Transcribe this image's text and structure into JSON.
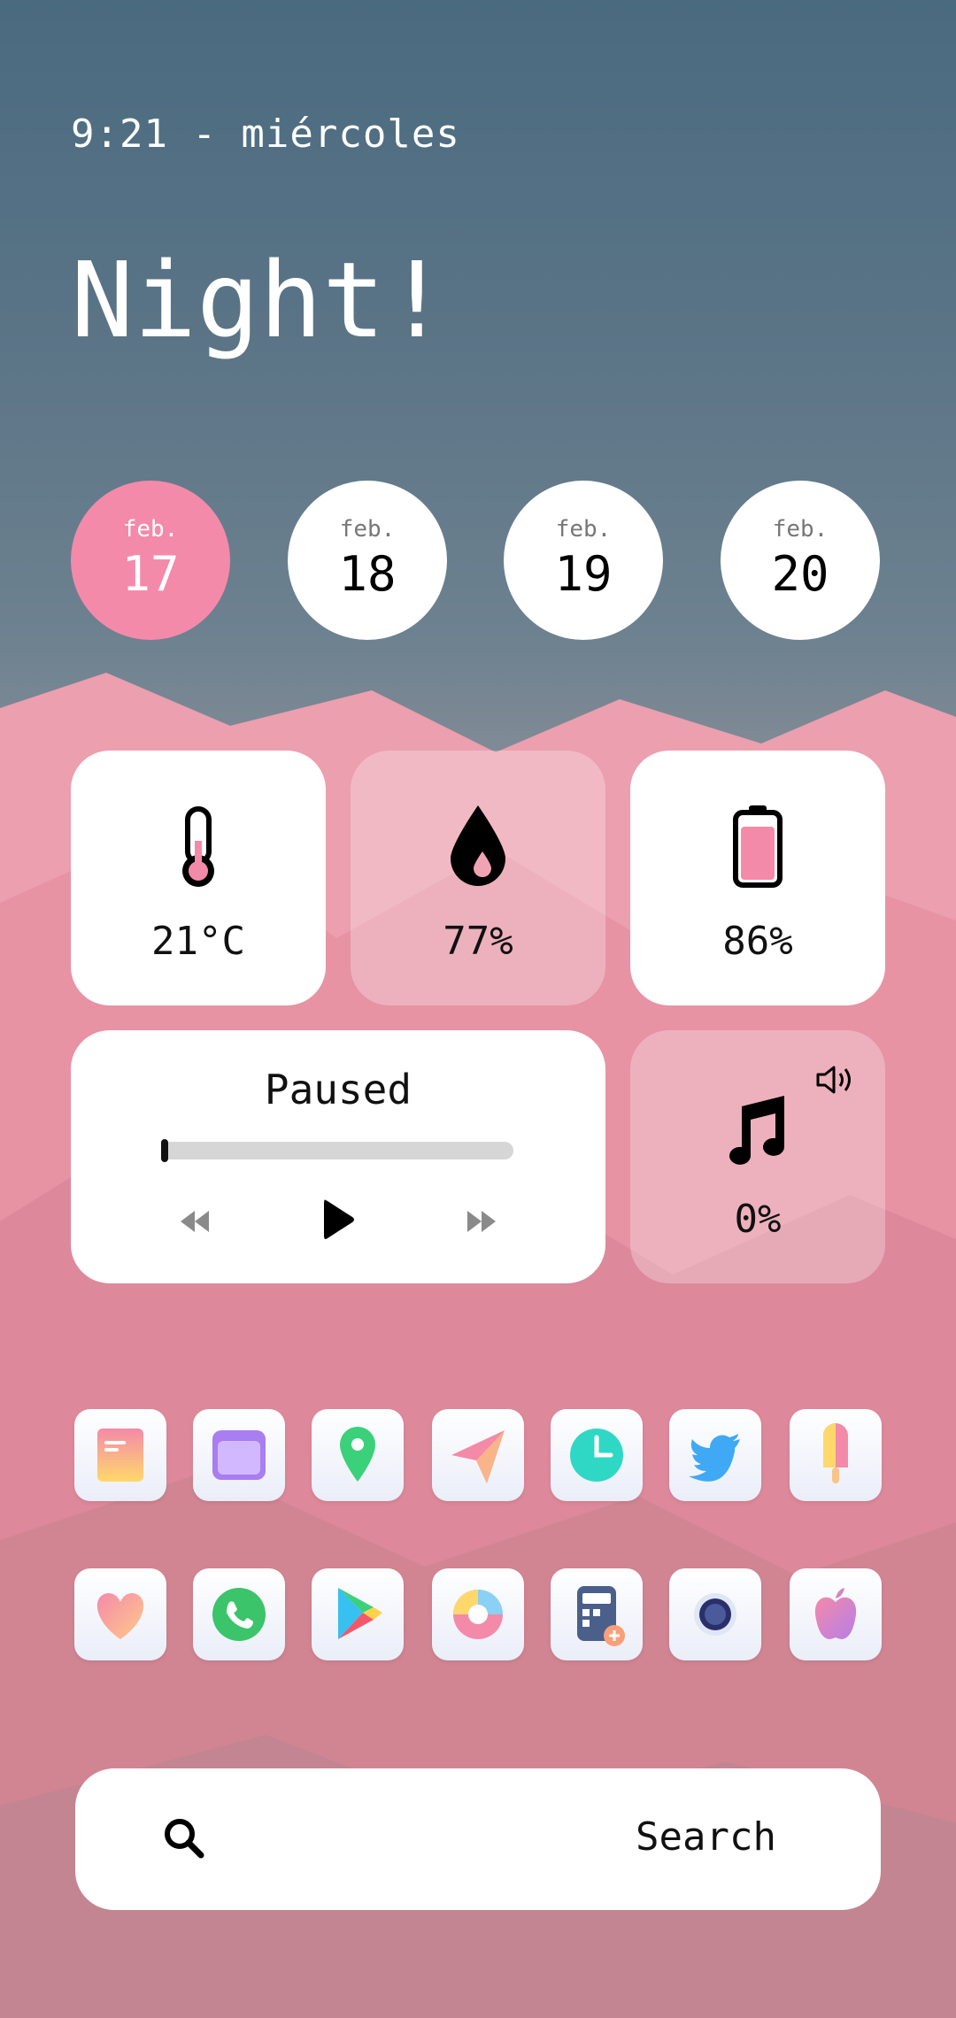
{
  "status": {
    "time_day": "9:21 - miércoles"
  },
  "greeting": "Night!",
  "dates": [
    {
      "month": "feb.",
      "day": "17",
      "active": true
    },
    {
      "month": "feb.",
      "day": "18",
      "active": false
    },
    {
      "month": "feb.",
      "day": "19",
      "active": false
    },
    {
      "month": "feb.",
      "day": "20",
      "active": false
    }
  ],
  "widgets": {
    "temperature": {
      "value": "21°C",
      "icon": "thermometer-icon"
    },
    "humidity": {
      "value": "77%",
      "icon": "water-drop-icon"
    },
    "battery": {
      "value": "86%",
      "icon": "battery-icon",
      "level": 0.86
    },
    "media": {
      "status": "Paused",
      "progress": 0.0
    },
    "volume": {
      "value": "0%",
      "icon": "music-note-icon"
    }
  },
  "apps_row1": [
    "mail-icon",
    "files-icon",
    "maps-icon",
    "send-icon",
    "clock-icon",
    "twitter-icon",
    "popsicle-icon"
  ],
  "apps_row2": [
    "health-icon",
    "whatsapp-icon",
    "play-store-icon",
    "chart-icon",
    "calculator-icon",
    "camera-icon",
    "apple-icon"
  ],
  "search": {
    "label": "Search"
  },
  "colors": {
    "accent": "#f48aa9",
    "card": "#ffffff"
  }
}
